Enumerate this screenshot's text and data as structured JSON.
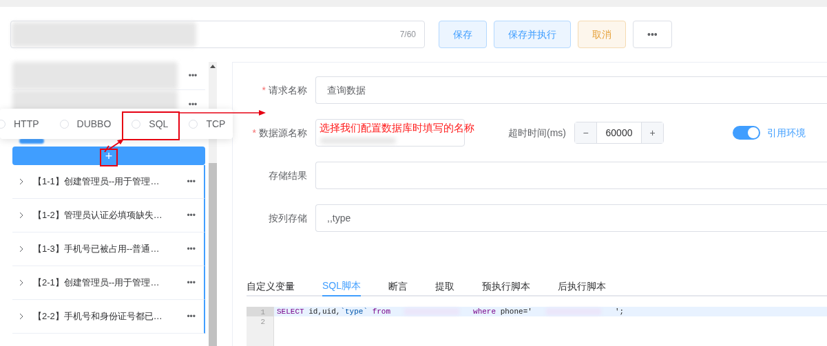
{
  "header": {
    "name_counter": "7/60",
    "buttons": [
      {
        "label": "保存",
        "kind": "primary"
      },
      {
        "label": "保存并执行",
        "kind": "primary"
      },
      {
        "label": "取消",
        "kind": "warning"
      },
      {
        "label": "•••",
        "kind": "plain"
      }
    ]
  },
  "sidebar": {
    "more_label": "•••",
    "protocol_popover": [
      {
        "label": "HTTP",
        "selected": false
      },
      {
        "label": "DUBBO",
        "selected": false
      },
      {
        "label": "SQL",
        "selected": false
      },
      {
        "label": "TCP",
        "selected": false
      }
    ],
    "add_label": "+",
    "items": [
      {
        "title": "【1-1】创建管理员--用于管理…"
      },
      {
        "title": "【1-2】管理员认证必填项缺失…"
      },
      {
        "title": "【1-3】手机号已被占用--普通…"
      },
      {
        "title": "【2-1】创建管理员--用于管理…"
      },
      {
        "title": "【2-2】手机号和身份证号都已…"
      }
    ]
  },
  "form": {
    "fields": [
      {
        "label": "请求名称",
        "required_mark": "*",
        "value": "查询数据"
      },
      {
        "label": "存储结果"
      },
      {
        "label": "按列存储",
        "value": ",,type"
      }
    ],
    "datasource": {
      "label": "数据源名称",
      "required_mark": "*",
      "annotation": "选择我们配置数据库时填写的名称"
    },
    "timeout": {
      "label": "超时时间(ms)",
      "minus": "−",
      "value": "60000",
      "plus": "+"
    },
    "env_switch": {
      "label": "引用环境",
      "on": true
    }
  },
  "tabs": [
    {
      "label": "自定义变量",
      "selected": false
    },
    {
      "label": "SQL脚本",
      "selected": true
    },
    {
      "label": "断言",
      "selected": false
    },
    {
      "label": "提取",
      "selected": false
    },
    {
      "label": "预执行脚本",
      "selected": false
    },
    {
      "label": "后执行脚本",
      "selected": false
    }
  ],
  "editor": {
    "lines": [
      {
        "number": "1",
        "active": true,
        "tokens": [
          {
            "kind": "keyword",
            "text": "SELECT"
          },
          {
            "kind": "plain",
            "text": " id,uid,"
          },
          {
            "kind": "quoted",
            "text": "`type`"
          },
          {
            "kind": "keyword",
            "text": " from"
          },
          {
            "kind": "redacted"
          },
          {
            "kind": "keyword",
            "text": "where"
          },
          {
            "kind": "plain",
            "text": " phone='"
          },
          {
            "kind": "redacted"
          },
          {
            "kind": "plain",
            "text": "';"
          }
        ]
      },
      {
        "number": "2",
        "active": false
      }
    ]
  }
}
